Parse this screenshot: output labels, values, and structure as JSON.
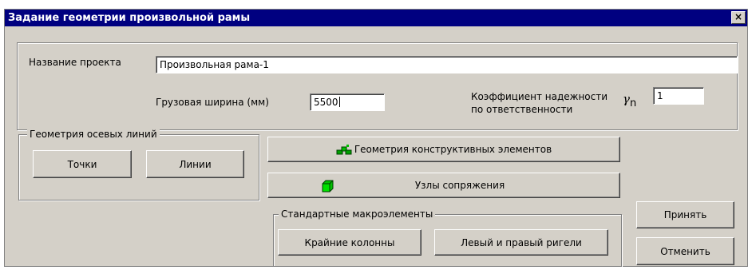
{
  "window": {
    "title": "Задание геометрии произвольной рамы",
    "close_label": "×"
  },
  "project": {
    "name_label": "Название проекта",
    "name_value": "Произвольная рама-1"
  },
  "load_width": {
    "label": "Грузовая ширина (мм)",
    "value": "5500"
  },
  "reliability": {
    "label_line1": "Коэффициент надежности",
    "label_line2": "по ответственности",
    "symbol": "γ",
    "subscript": "n",
    "value": "1"
  },
  "axes_group": {
    "title": "Геометрия осевых линий",
    "points_label": "Точки",
    "lines_label": "Линии"
  },
  "buttons": {
    "geometry_label": "Геометрия конструктивных элементов",
    "nodes_label": "Узлы сопряжения",
    "accept_label": "Принять",
    "cancel_label": "Отменить"
  },
  "macro_group": {
    "title": "Стандартные макроэлементы",
    "outer_columns_label": "Крайние колонны",
    "girders_label": "Левый и правый ригели"
  }
}
